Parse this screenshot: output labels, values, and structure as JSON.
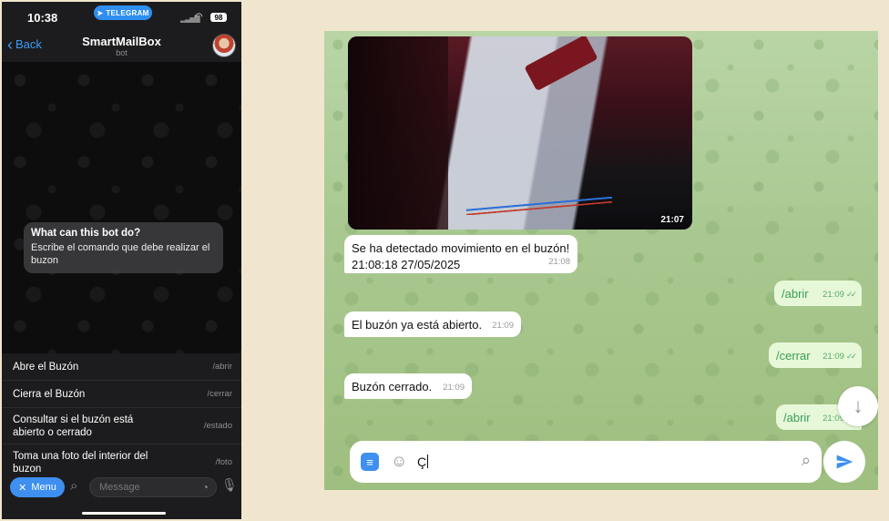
{
  "phone": {
    "status": {
      "time": "10:38",
      "telegram_pill": "TELEGRAM",
      "battery": "98"
    },
    "header": {
      "back_label": "Back",
      "title": "SmartMailBox",
      "subtitle": "bot"
    },
    "bot_info": {
      "title": "What can this bot do?",
      "text": "Escribe el comando que debe realizar el buzon"
    },
    "commands": [
      {
        "description": "Abre el Buzón",
        "command": "/abrir"
      },
      {
        "description": "Cierra el Buzón",
        "command": "/cerrar"
      },
      {
        "description": "Consultar si el buzón está abierto o cerrado",
        "command": "/estado"
      },
      {
        "description": "Toma una foto del interior del buzon",
        "command": "/foto"
      }
    ],
    "input": {
      "menu_label": "Menu",
      "placeholder": "Message"
    }
  },
  "desktop": {
    "photo": {
      "time": "21:07"
    },
    "messages": [
      {
        "direction": "in",
        "text": "Se ha detectado movimiento en el buzón!",
        "text2": "21:08:18 27/05/2025",
        "time": "21:08"
      },
      {
        "direction": "out",
        "text": "/abrir",
        "time": "21:09",
        "checks": "✓✓"
      },
      {
        "direction": "in",
        "text": "El buzón ya está abierto.",
        "time": "21:09"
      },
      {
        "direction": "out",
        "text": "/cerrar",
        "time": "21:09",
        "checks": "✓✓"
      },
      {
        "direction": "in",
        "text": "Buzón cerrado.",
        "time": "21:09"
      },
      {
        "direction": "out",
        "text": "/abrir",
        "time": "21:09",
        "checks": "✓✓"
      }
    ],
    "composer": {
      "value": "Ç"
    }
  },
  "colors": {
    "accent": "#3e8ff0",
    "outgoing_bubble": "#e7f8d8",
    "incoming_bubble": "#ffffff"
  }
}
